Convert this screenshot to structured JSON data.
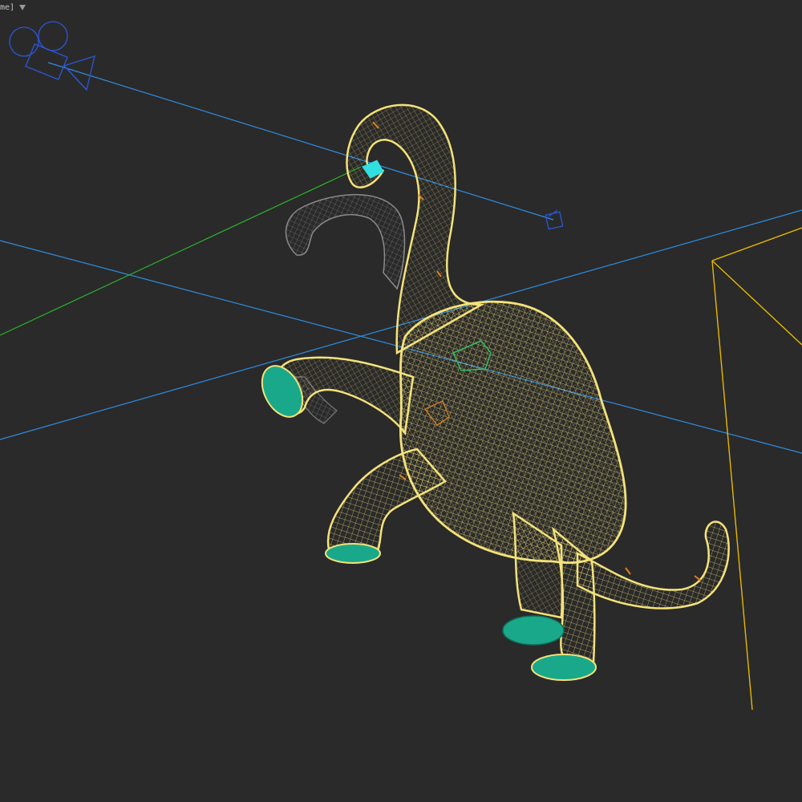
{
  "viewport": {
    "label": "me]",
    "background": "#2a2a2a"
  },
  "colors": {
    "selected_wire": "#f4e27a",
    "ghost_wire": "#8a8a8a",
    "foot_fill": "#1aa88a",
    "foot_edge": "#0f6f5a",
    "camera": "#2b56d8",
    "camera_line": "#2f8ce0",
    "horizon_line": "#2f8ce0",
    "grid_axis": "#2bb52b",
    "frame_box": "#e6b800",
    "detail_orange": "#e08020",
    "detail_cyan": "#30e0e0",
    "detail_green": "#30c060"
  },
  "icons": {
    "viewport_menu": "filter-icon",
    "camera": "camera-icon",
    "camera_target": "target-box-icon"
  }
}
